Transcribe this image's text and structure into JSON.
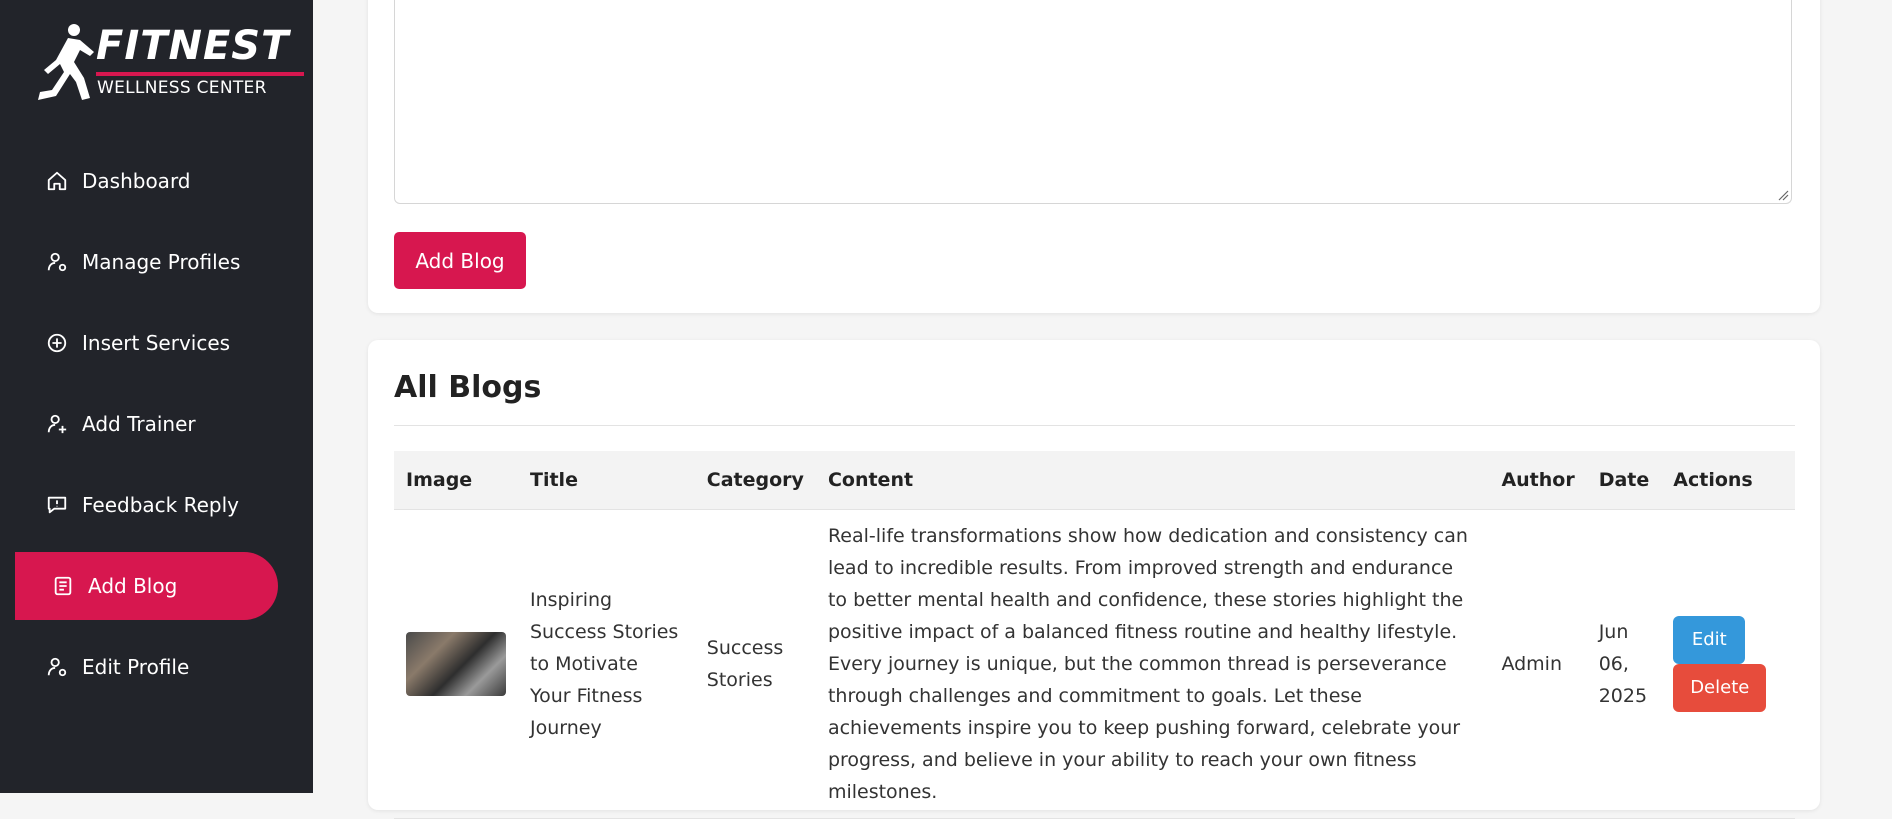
{
  "brand": {
    "name": "FITNEST",
    "subtitle": "WELLNESS CENTER"
  },
  "sidebar": {
    "items": [
      {
        "label": "Dashboard",
        "icon": "home-icon"
      },
      {
        "label": "Manage Profiles",
        "icon": "user-gear-icon"
      },
      {
        "label": "Insert Services",
        "icon": "plus-circle-icon"
      },
      {
        "label": "Add Trainer",
        "icon": "user-plus-icon"
      },
      {
        "label": "Feedback Reply",
        "icon": "feedback-icon"
      },
      {
        "label": "Add Blog",
        "icon": "blog-icon",
        "active": true
      },
      {
        "label": "Edit Profile",
        "icon": "user-gear-icon"
      }
    ]
  },
  "form": {
    "submit_label": "Add Blog"
  },
  "blogs": {
    "heading": "All Blogs",
    "columns": [
      "Image",
      "Title",
      "Category",
      "Content",
      "Author",
      "Date",
      "Actions"
    ],
    "rows": [
      {
        "title": "Inspiring Success Stories to Motivate Your Fitness Journey",
        "category": "Success Stories",
        "content": "Real-life transformations show how dedication and consistency can lead to incredible results. From improved strength and endurance to better mental health and confidence, these stories highlight the positive impact of a balanced fitness routine and healthy lifestyle. Every journey is unique, but the common thread is perseverance through challenges and commitment to goals. Let these achievements inspire you to keep pushing forward, celebrate your progress, and believe in your ability to reach your own fitness milestones.",
        "author": "Admin",
        "date": "Jun 06, 2025",
        "edit_label": "Edit",
        "delete_label": "Delete"
      }
    ]
  },
  "colors": {
    "sidebar_bg": "#22242a",
    "accent": "#d7174f",
    "edit": "#3498db",
    "delete": "#e74c3c"
  }
}
